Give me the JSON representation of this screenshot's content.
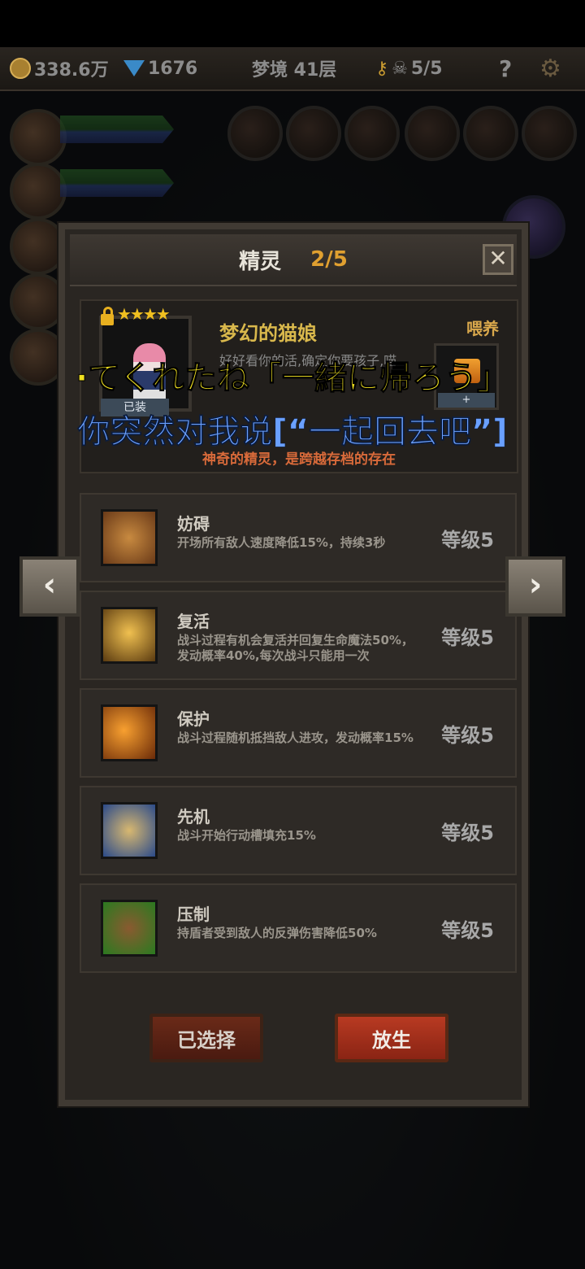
{
  "hud": {
    "gold": "338.6万",
    "diamonds": "1676",
    "dungeon": "梦境 41层",
    "keys": "5/5",
    "help": "?"
  },
  "panel": {
    "title": "精灵",
    "count": "2/5",
    "close": "✕"
  },
  "sprite": {
    "stars": "★★★★",
    "name": "梦幻的猫娘",
    "desc": "好好看你的活,确定你要孩子,喵~",
    "portrait_tag": "已装",
    "feed_label": "喂养",
    "feed_tag": "+",
    "quote": "神奇的精灵，是跨越存档的存在"
  },
  "skills": [
    {
      "name": "妨碍",
      "desc": "开场所有敌人速度降低15%，持续3秒",
      "level": "等级5",
      "icon": "shackled-boot-icon"
    },
    {
      "name": "复活",
      "desc": "战斗过程有机会复活并回复生命魔法50%，发动概率40%,每次战斗只能用一次",
      "level": "等级5",
      "icon": "revive-figure-icon"
    },
    {
      "name": "保护",
      "desc": "战斗过程随机抵挡敌人进攻，发动概率15%",
      "level": "等级5",
      "icon": "shield-figure-icon"
    },
    {
      "name": "先机",
      "desc": "战斗开始行动槽填充15%",
      "level": "等级5",
      "icon": "leopard-icon"
    },
    {
      "name": "压制",
      "desc": "持盾者受到敌人的反弹伤害降低50%",
      "level": "等级5",
      "icon": "beast-claw-icon"
    }
  ],
  "buttons": {
    "selected": "已选择",
    "release": "放生"
  },
  "nav": {
    "prev": "‹",
    "next": "›"
  },
  "subtitles": {
    "jp": "·てくれたね「一緒に帰ろう」",
    "zh": "你突然对我说[“一起回去吧”]"
  },
  "colors": {
    "accent_gold": "#e0a030",
    "quote_orange": "#d86a3a",
    "subtitle_yellow": "#f0e020",
    "subtitle_blue": "#6aa0ff"
  }
}
